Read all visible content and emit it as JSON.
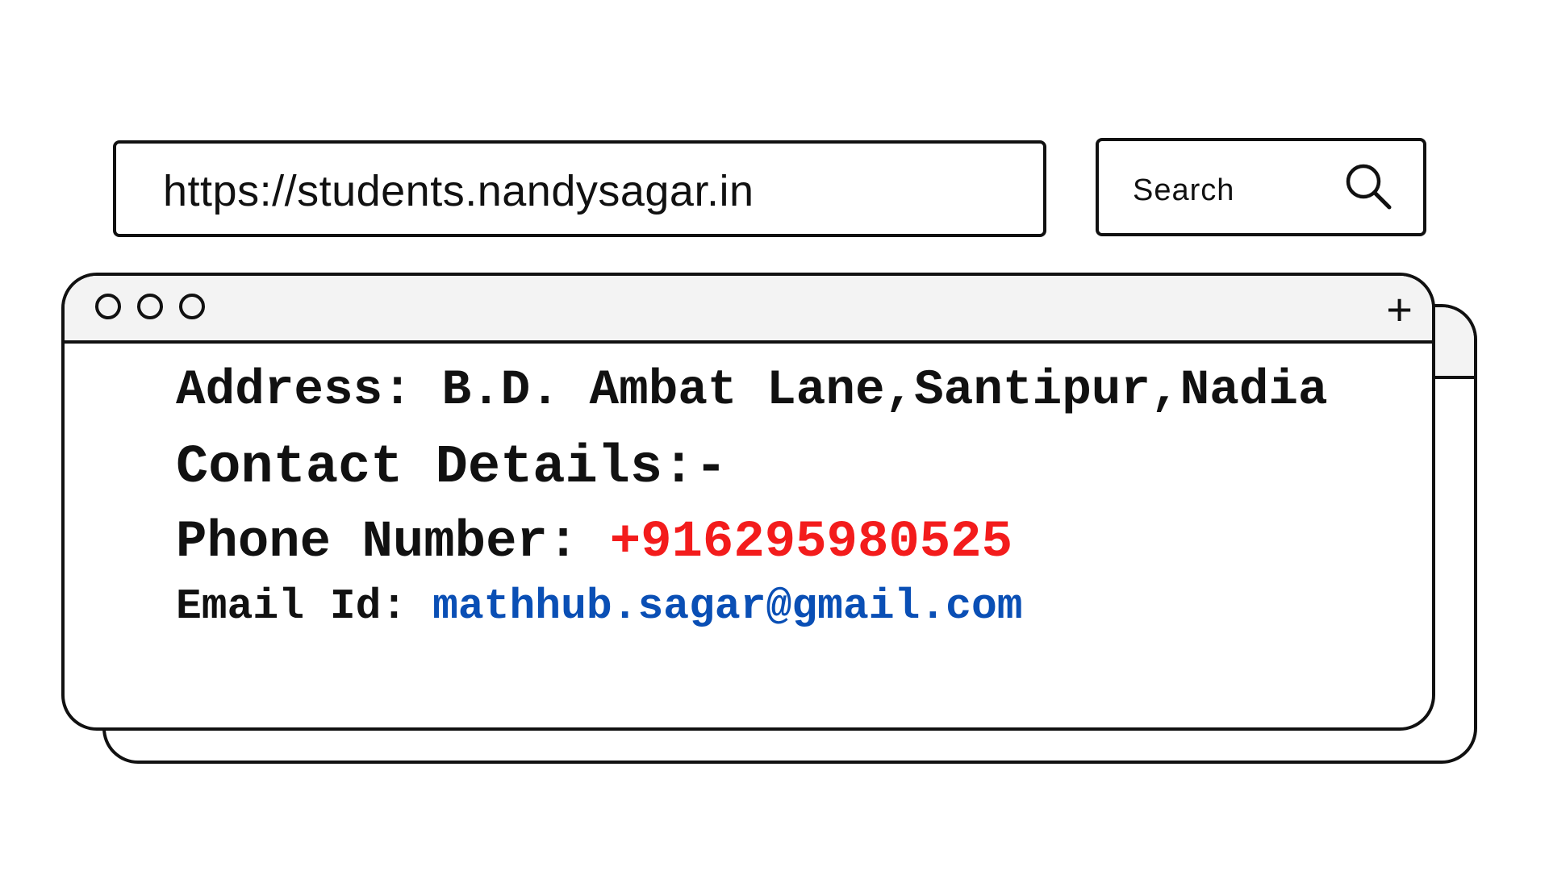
{
  "address_bar": {
    "url": "https://students.nandysagar.in"
  },
  "search": {
    "placeholder": "Search",
    "icon": "search-icon"
  },
  "window": {
    "controls": [
      "circle",
      "circle",
      "circle"
    ],
    "new_tab_icon": "plus-icon",
    "address_label": "Address:",
    "address_value": "B.D. Ambat Lane,Santipur,Nadia",
    "contact_heading": "Contact Details:-",
    "phone_label": "Phone Number:",
    "phone_value": "+916295980525",
    "email_label": "Email Id:",
    "email_value": "mathhub.sagar@gmail.com"
  },
  "colors": {
    "phone": "#f31c1c",
    "email": "#0a4fb5",
    "header": "#f3f3f3"
  }
}
